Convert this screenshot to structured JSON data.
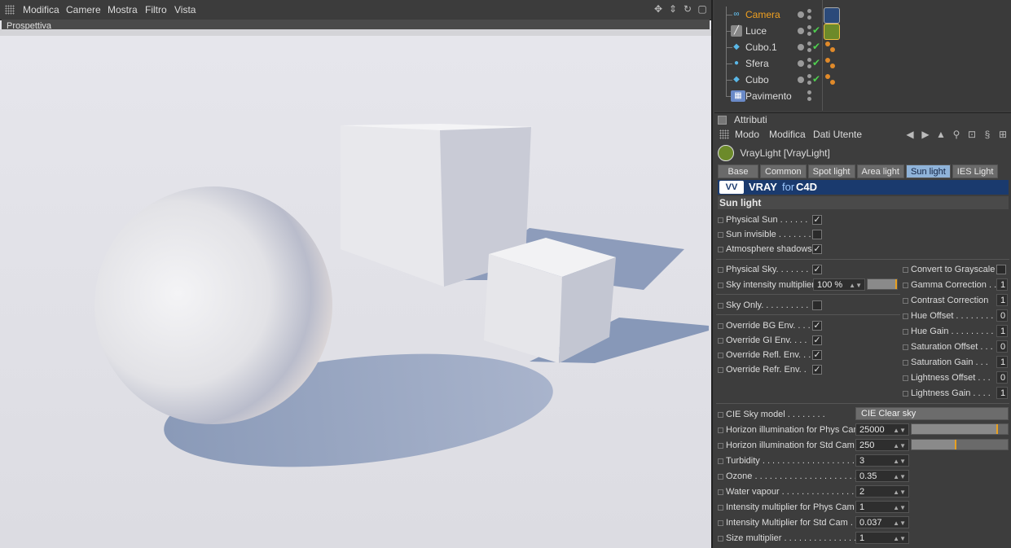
{
  "viewport": {
    "menu": [
      "Modifica",
      "Camere",
      "Mostra",
      "Filtro",
      "Vista"
    ],
    "view_label": "Prospettiva",
    "icons": [
      "move-icon",
      "zoom-icon",
      "rotate-icon",
      "maximize-icon"
    ]
  },
  "objects": [
    {
      "name": "Camera",
      "icon": "camera-icon",
      "highlight": true
    },
    {
      "name": "Luce",
      "icon": "light-icon",
      "highlight": false
    },
    {
      "name": "Cubo.1",
      "icon": "cube-icon",
      "highlight": false
    },
    {
      "name": "Sfera",
      "icon": "sphere-icon",
      "highlight": false
    },
    {
      "name": "Cubo",
      "icon": "cube-icon",
      "highlight": false
    },
    {
      "name": "Pavimento",
      "icon": "floor-icon",
      "highlight": false
    }
  ],
  "attributes": {
    "title": "Attributi",
    "menu": [
      "Modo",
      "Modifica",
      "Dati Utente"
    ],
    "object_title": "VrayLight [VrayLight]",
    "tabs": [
      "Base",
      "Common",
      "Spot light",
      "Area light",
      "Sun light",
      "IES Light"
    ],
    "active_tab": "Sun light",
    "banner": {
      "vray": "VRAY",
      "for": "for",
      "c4d": "C4D"
    },
    "section": "Sun light"
  },
  "sun": {
    "physical_sun": "Physical Sun . . . . . .",
    "sun_invisible": "Sun invisible . . . . . . .",
    "atmosphere_shadows": "Atmosphere shadows",
    "physical_sky": "Physical Sky. . . . . . .",
    "sky_intensity_label": "Sky intensity multiplier",
    "sky_intensity_value": "100 %",
    "sky_only": "Sky Only. . . . . . . . . .",
    "override_bg": "Override BG Env. . . .",
    "override_gi": "Override GI Env. . . .",
    "override_refl": "Override Refl. Env. . .",
    "override_refr": "Override Refr. Env. .",
    "convert_gray": "Convert to Grayscale",
    "gamma_label": "Gamma Correction . .",
    "gamma_value": "1",
    "contrast_label": "Contrast Correction",
    "contrast_value": "1",
    "hue_offset_label": "Hue Offset . . . . . . . .",
    "hue_offset_value": "0",
    "hue_gain_label": "Hue Gain . . . . . . . . .",
    "hue_gain_value": "1",
    "sat_offset_label": "Saturation Offset . . .",
    "sat_offset_value": "0",
    "sat_gain_label": "Saturation Gain . . .",
    "sat_gain_value": "1",
    "light_offset_label": "Lightness Offset . . .",
    "light_offset_value": "0",
    "light_gain_label": "Lightness Gain . . . .",
    "light_gain_value": "1",
    "cie_label": "CIE Sky model . . . . . . . .",
    "cie_value": "CIE Clear sky",
    "horizon_phys_label": "Horizon illumination for Phys Cam",
    "horizon_phys_value": "25000",
    "horizon_std_label": "Horizon illumination for Std Cam",
    "horizon_std_value": "250",
    "turbidity_label": "Turbidity . . . . . . . . . . . . . . . . . . .",
    "turbidity_value": "3",
    "ozone_label": "Ozone . . . . . . . . . . . . . . . . . . . . .",
    "ozone_value": "0.35",
    "water_label": "Water vapour . . . . . . . . . . . . . . .",
    "water_value": "2",
    "int_phys_label": "Intensity multiplier for Phys Cam",
    "int_phys_value": "1",
    "int_std_label": "Intensity Multiplier for Std Cam . .",
    "int_std_value": "0.037",
    "size_label": "Size multiplier . . . . . . . . . . . . . . .",
    "size_value": "1"
  },
  "colors": {
    "accent": "#e8a020",
    "tab_active": "#8fb3d9",
    "banner": "#1a3a6e",
    "highlight_text": "#f0a020"
  }
}
